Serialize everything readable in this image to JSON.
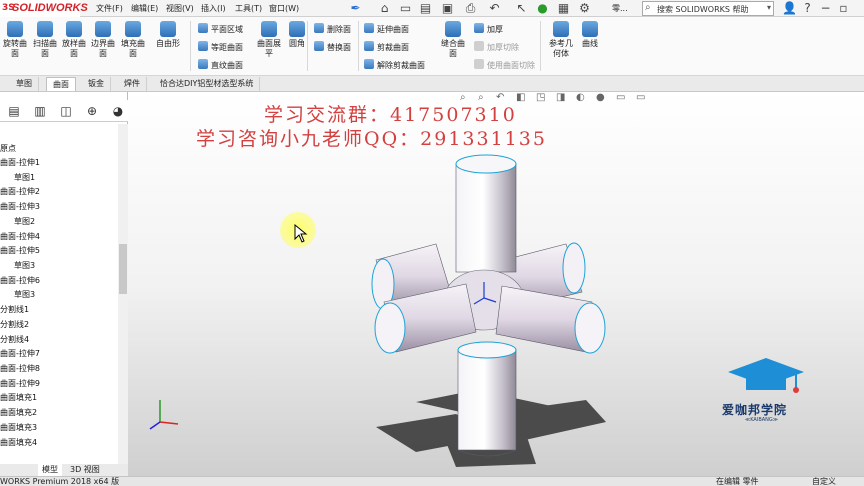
{
  "app": {
    "logo_prefix": "3S",
    "logo_text": "SOLIDWORKS"
  },
  "menu": [
    "文件(F)",
    "编辑(E)",
    "视图(V)",
    "插入(I)",
    "工具(T)",
    "窗口(W)"
  ],
  "window_extra": "零...",
  "search": {
    "placeholder": "搜索 SOLIDWORKS 帮助"
  },
  "ribbon": {
    "big": [
      {
        "label": "旋转曲面"
      },
      {
        "label": "扫描曲面"
      },
      {
        "label": "放样曲面"
      },
      {
        "label": "边界曲面"
      },
      {
        "label": "填充曲面"
      },
      {
        "label": "自由形"
      },
      {
        "label": "曲面展平"
      },
      {
        "label": "圆角"
      },
      {
        "label": "缝合曲面"
      },
      {
        "label": "参考几何体"
      },
      {
        "label": "曲线"
      }
    ],
    "small": {
      "planar": "平面区域",
      "offset": "等距曲面",
      "ruled": "直纹曲面",
      "delete_face": "删除面",
      "replace_face": "替换面",
      "extend": "延伸曲面",
      "trim": "剪裁曲面",
      "untrim": "解除剪裁曲面",
      "thicken": "加厚",
      "thicken_cut": "加厚切除",
      "surface_cut": "使用曲面切除"
    }
  },
  "tabs": [
    "草图",
    "曲面",
    "钣金",
    "焊件",
    "恰合达DIY铝型材选型系统"
  ],
  "active_tab": "曲面",
  "tree": [
    "原点",
    "曲面-拉伸1",
    "草图1",
    "曲面-拉伸2",
    "曲面-拉伸3",
    "草图2",
    "曲面-拉伸4",
    "曲面-拉伸5",
    "草图3",
    "曲面-拉伸6",
    "草图3",
    "分割线1",
    "分割线2",
    "分割线4",
    "曲面-拉伸7",
    "曲面-拉伸8",
    "曲面-拉伸9",
    "曲面填充1",
    "曲面填充2",
    "曲面填充3",
    "曲面填充4"
  ],
  "bottom_tabs": [
    "模型",
    "3D 视图"
  ],
  "status": {
    "left": "WORKS Premium 2018 x64 版",
    "mode": "在编辑 零件",
    "custom": "自定义"
  },
  "watermark": {
    "line1": "学习交流群：417507310",
    "line2": "学习咨询小九老师QQ：291331135"
  },
  "brand": {
    "name": "爱咖邦学院",
    "sub": "≪KAIBANG≫"
  },
  "colors": {
    "accent": "#d2232a",
    "watermark": "#d34040",
    "brand": "#1a3a6b"
  }
}
